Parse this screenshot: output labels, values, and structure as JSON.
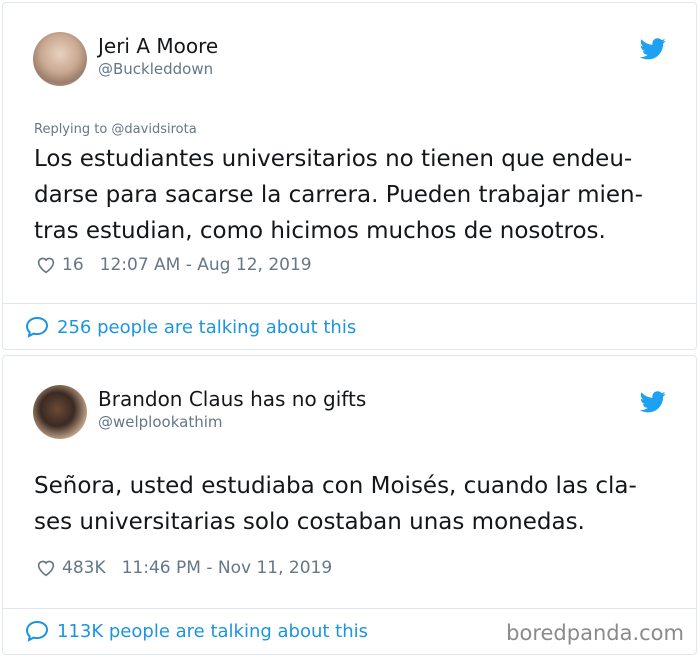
{
  "tweets": [
    {
      "name": "Jeri A Moore",
      "handle": "@Buckleddown",
      "replying_to": "Replying to @davidsirota",
      "text": "Los estudiantes universitarios no tienen que endeu-darse para sacarse la carrera. Pueden trabajar mien-tras estudian, como hicimos muchos de nosotros.",
      "likes": "16",
      "timestamp": "12:07 AM - Aug 12, 2019",
      "talking": "256 people are talking about this"
    },
    {
      "name": "Brandon Claus has no gifts",
      "handle": "@welplookathim",
      "text": "Señora, usted estudiaba con Moisés, cuando las cla-ses universitarias solo costaban unas monedas.",
      "likes": "483K",
      "timestamp": "11:46 PM - Nov 11, 2019",
      "talking": "113K people are talking about this"
    }
  ],
  "watermark": "boredpanda.com",
  "colors": {
    "twitter_blue": "#1da1f2",
    "link_blue": "#1b95e0",
    "muted": "#657786"
  },
  "icons": [
    "twitter-bird-icon",
    "heart-icon",
    "speech-bubble-icon"
  ]
}
